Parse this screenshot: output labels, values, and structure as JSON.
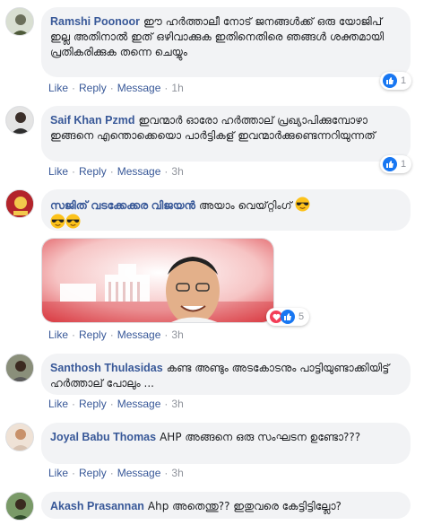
{
  "actions": {
    "like": "Like",
    "reply": "Reply",
    "message": "Message",
    "dot": "·"
  },
  "comments": [
    {
      "author": "Ramshi Poonoor",
      "text": "ഈ ഹർത്താലീ നോട് ജനങ്ങൾക്ക് ഒരു യോജിപ് ഇല്ല അതിനാൽ ഇത് ഒഴിവാക്കുക ഇതിനെതിരെ ഞങ്ങൾ ശക്തമായി പ്രതികരിക്കുക തന്നെ ചെയ്യും",
      "time": "1h",
      "reactions": "1"
    },
    {
      "author": "Saif Khan Pzmd",
      "text": "ഇവന്മാർ ഓരോ ഹർത്താല് പ്രഖ്യാപിക്കുമ്പോഴാ ഇങ്ങനെ എന്തൊക്കെയൊ പാർട്ടികള് ഇവന്മാർക്കുണ്ടെന്നറിയുന്നത്",
      "time": "3h",
      "reactions": "1"
    },
    {
      "author": "സജിത് വടക്കേക്കര വിജയൻ",
      "text": "അയാം വെയ്റ്റിംഗ്",
      "time": "3h",
      "reactions": "5"
    },
    {
      "author": "Santhosh Thulasidas",
      "text": "കണ്ട അണ്ടും അടകോടനും പാട്ടിയുണ്ടാക്കിയിട്ട് ഹർത്താല് പോലും ...",
      "time": "3h"
    },
    {
      "author": "Joyal Babu Thomas",
      "text": "AHP അങ്ങനെ ഒരു സംഘടന ഉണ്ടോ???",
      "time": "3h"
    },
    {
      "author": "Akash Prasannan",
      "text": "Ahp അതെന്തു?? ഇതുവരെ കേട്ടിട്ടില്ലോ?"
    }
  ]
}
